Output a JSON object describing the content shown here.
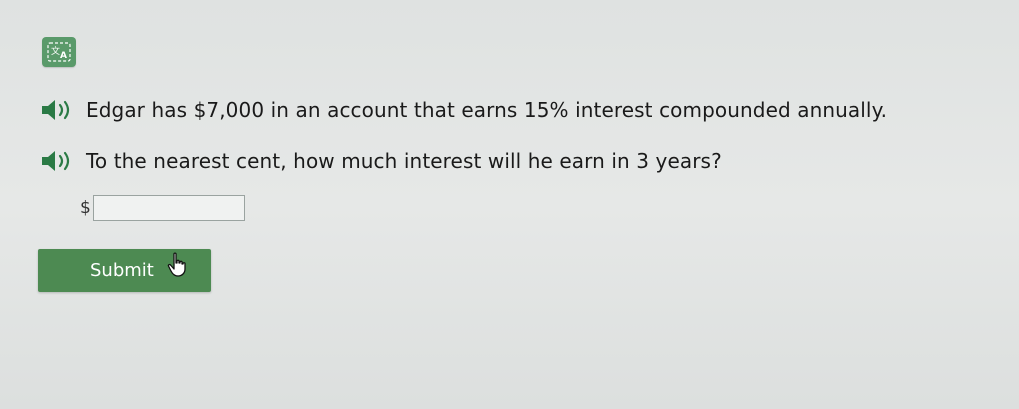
{
  "toolbar": {
    "translate_icon": "translate-icon"
  },
  "question": {
    "line1": "Edgar has $7,000 in an account that earns 15% interest compounded annually.",
    "line2": "To the nearest cent, how much interest will he earn in 3 years?",
    "speaker_icon": "speaker-icon"
  },
  "answer": {
    "currency_symbol": "$",
    "value": "",
    "placeholder": ""
  },
  "submit": {
    "label": "Submit"
  },
  "colors": {
    "accent": "#4d8a52",
    "translate_button": "#5a9a6a",
    "speaker": "#2a7a45"
  }
}
